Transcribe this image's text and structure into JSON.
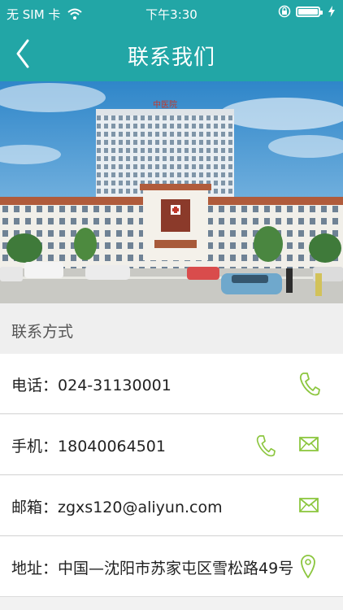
{
  "status": {
    "carrier": "无 SIM 卡",
    "time": "下午3:30"
  },
  "header": {
    "title": "联系我们"
  },
  "section": {
    "title": "联系方式"
  },
  "contacts": [
    {
      "label": "电话：",
      "value": "024-31130001"
    },
    {
      "label": "手机：",
      "value": "18040064501"
    },
    {
      "label": "邮箱：",
      "value": "zgxs120@aliyun.com"
    },
    {
      "label": "地址：",
      "value": "中国—沈阳市苏家屯区雪松路49号"
    }
  ],
  "image": {
    "sign_text": "中医院"
  },
  "colors": {
    "brand": "#22a6a6",
    "icon": "#8cc63f"
  },
  "icons": [
    "back-chevron-icon",
    "wifi-icon",
    "lock-rotation-icon",
    "battery-icon",
    "phone-icon",
    "mail-icon",
    "location-pin-icon"
  ]
}
